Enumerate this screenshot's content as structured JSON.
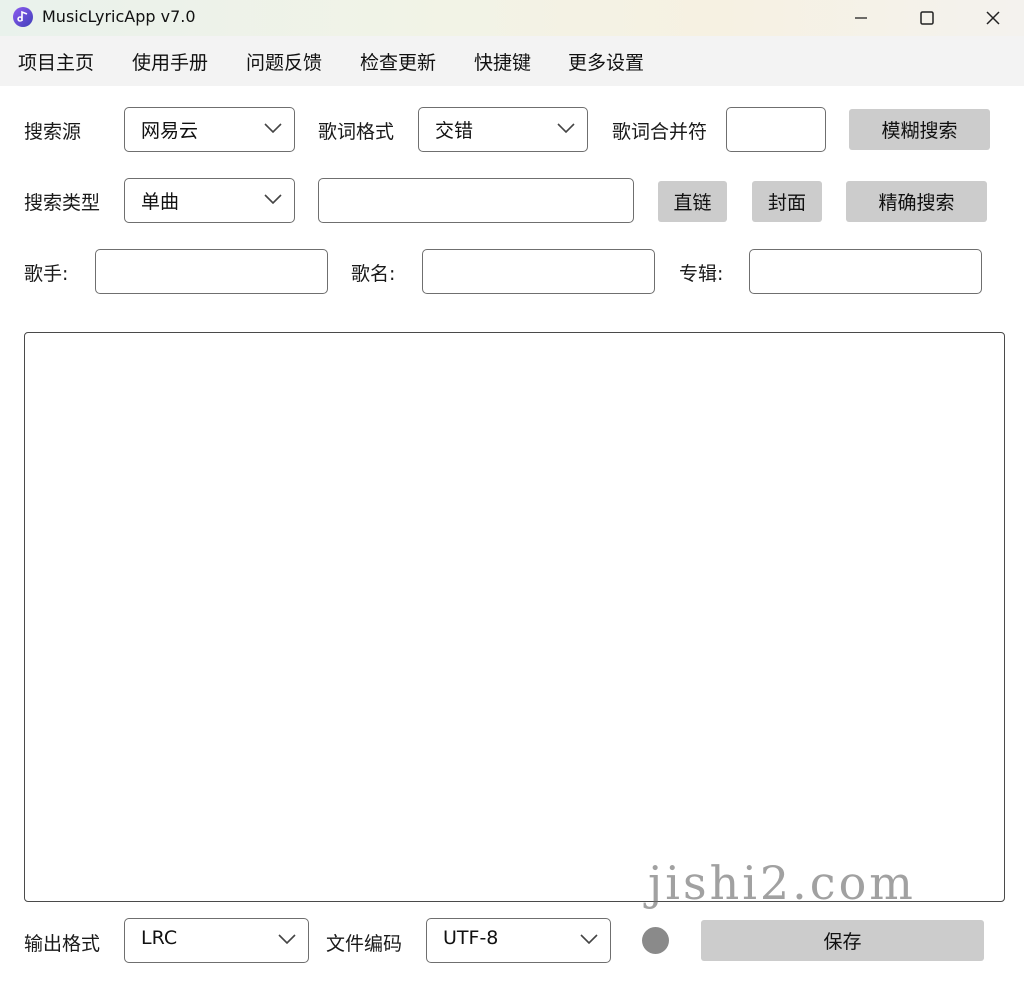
{
  "window": {
    "title": "MusicLyricApp v7.0",
    "minimize_icon": "minimize-icon",
    "maximize_icon": "maximize-icon",
    "close_icon": "close-icon"
  },
  "menu": [
    {
      "label": "项目主页"
    },
    {
      "label": "使用手册"
    },
    {
      "label": "问题反馈"
    },
    {
      "label": "检查更新"
    },
    {
      "label": "快捷键"
    },
    {
      "label": "更多设置"
    }
  ],
  "row1": {
    "search_source_label": "搜索源",
    "search_source_value": "网易云",
    "lyric_format_label": "歌词格式",
    "lyric_format_value": "交错",
    "merge_char_label": "歌词合并符",
    "merge_char_value": "",
    "fuzzy_search_label": "模糊搜索"
  },
  "row2": {
    "search_type_label": "搜索类型",
    "search_type_value": "单曲",
    "search_input_value": "",
    "direct_link_label": "直链",
    "cover_label": "封面",
    "exact_search_label": "精确搜索"
  },
  "row3": {
    "singer_label": "歌手:",
    "singer_value": "",
    "song_label": "歌名:",
    "song_value": "",
    "album_label": "专辑:",
    "album_value": ""
  },
  "output": {
    "lyrics_text": "",
    "format_label": "输出格式",
    "format_value": "LRC",
    "encoding_label": "文件编码",
    "encoding_value": "UTF-8",
    "save_label": "保存"
  },
  "watermark": "jishi2.com",
  "colors": {
    "button_bg": "#cccccc",
    "status_dot": "#8a8a8a",
    "content_bg": "#ffffff"
  }
}
